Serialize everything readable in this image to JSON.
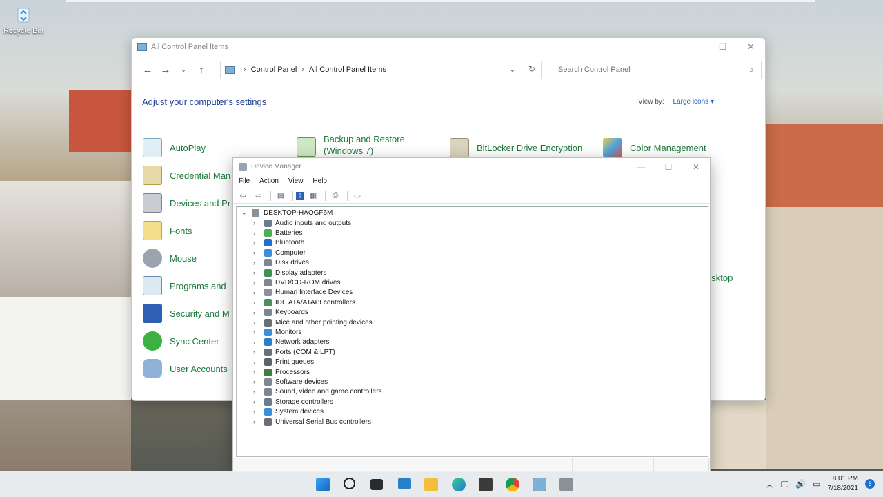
{
  "desktop": {
    "recycle_bin_label": "Recycle Bin"
  },
  "control_panel": {
    "window_title": "All Control Panel Items",
    "breadcrumb": [
      "Control Panel",
      "All Control Panel Items"
    ],
    "search_placeholder": "Search Control Panel",
    "heading": "Adjust your computer's settings",
    "view_by_label": "View by:",
    "view_by_value": "Large icons",
    "items": [
      {
        "label": "AutoPlay",
        "icon": "autoplay-icon"
      },
      {
        "label": "Backup and Restore",
        "label2": "(Windows 7)",
        "icon": "backup-icon"
      },
      {
        "label": "BitLocker Drive Encryption",
        "icon": "bitlocker-icon"
      },
      {
        "label": "Color Management",
        "icon": "color-management-icon"
      },
      {
        "label": "Credential Man",
        "icon": "credential-icon"
      },
      {
        "label": "Devices and Pr",
        "icon": "devices-printers-icon"
      },
      {
        "label": "Fonts",
        "icon": "fonts-icon"
      },
      {
        "label": "Mouse",
        "icon": "mouse-icon"
      },
      {
        "label": "Programs and",
        "icon": "programs-icon"
      },
      {
        "label": "Security and M",
        "icon": "security-icon"
      },
      {
        "label": "Sync Center",
        "icon": "sync-icon"
      },
      {
        "label": "User Accounts",
        "icon": "user-accounts-icon"
      },
      {
        "label": "esktop",
        "icon": ""
      }
    ]
  },
  "device_manager": {
    "window_title": "Device Manager",
    "menu": [
      "File",
      "Action",
      "View",
      "Help"
    ],
    "root": "DESKTOP-HAOGF6M",
    "categories": [
      "Audio inputs and outputs",
      "Batteries",
      "Bluetooth",
      "Computer",
      "Disk drives",
      "Display adapters",
      "DVD/CD-ROM drives",
      "Human Interface Devices",
      "IDE ATA/ATAPI controllers",
      "Keyboards",
      "Mice and other pointing devices",
      "Monitors",
      "Network adapters",
      "Ports (COM & LPT)",
      "Print queues",
      "Processors",
      "Software devices",
      "Sound, video and game controllers",
      "Storage controllers",
      "System devices",
      "Universal Serial Bus controllers"
    ]
  },
  "taskbar": {
    "time": "8:01 PM",
    "date": "7/18/2021",
    "notification_count": "6"
  },
  "colors": {
    "link_green": "#1b7a3a",
    "heading_blue": "#1e3d8f",
    "accent_blue": "#1a66c2"
  }
}
